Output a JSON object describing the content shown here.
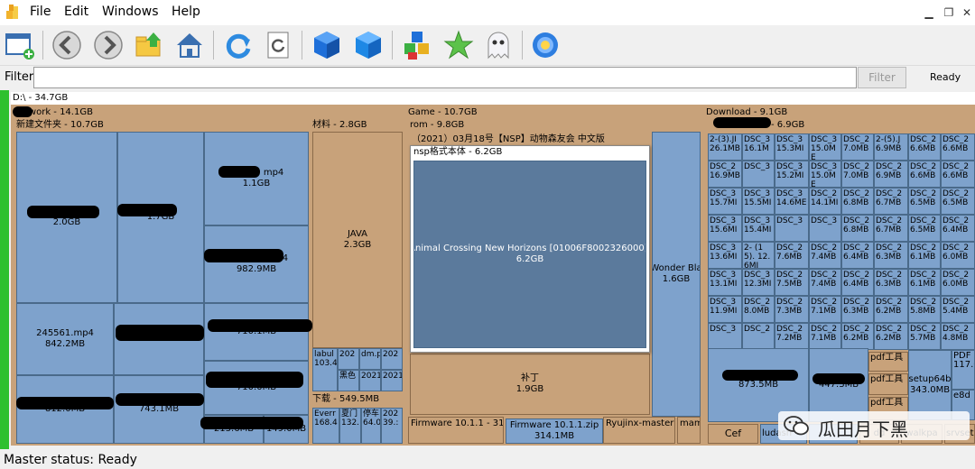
{
  "menu": {
    "file": "File",
    "edit": "Edit",
    "windows": "Windows",
    "help": "Help"
  },
  "filter": {
    "label": "Filter",
    "value": "",
    "button": "Filter",
    "status": "Ready"
  },
  "path_header": "D:\\ - 34.7GB",
  "sections": {
    "work": {
      "header": "work - 14.1GB",
      "sub": "新建文件夹 - 10.7GB",
      "materials": "材料 - 2.8GB",
      "downloads": "下载 - 549.5MB"
    },
    "game": {
      "header": "Game - 10.7GB",
      "rom": "rom - 9.8GB",
      "nsp_folder": "（2021）03月18号【NSP】动物森友会 中文版",
      "nsp_popup": "nsp格式本体 - 6.2GB"
    },
    "download": {
      "header": "Download - 9.1GB",
      "sub": "- 6.9GB"
    }
  },
  "blocks": {
    "b1": {
      "name": "mp4",
      "size": "2.0GB"
    },
    "b2": {
      "name": "",
      "size": "1.7GB"
    },
    "b3": {
      "name": "mp4",
      "size": "1.1GB"
    },
    "b4": {
      "name": "mp4",
      "size": "982.9MB"
    },
    "b5": {
      "name": "245561.mp4",
      "size": "842.2MB"
    },
    "b6": {
      "name": "",
      "size": "790.0MB"
    },
    "b7": {
      "name": "",
      "size": "710.1MB"
    },
    "b8": {
      "name": "",
      "size": "710.0MB"
    },
    "b9": {
      "name": "",
      "size": "812.0MB"
    },
    "b10": {
      "name": "",
      "size": "743.1MB"
    },
    "b11": {
      "name": "",
      "size": "213.6MB"
    },
    "b12": {
      "name": "",
      "size": "149.0MB"
    },
    "java": {
      "name": "JAVA",
      "size": "2.3GB"
    },
    "animal": {
      "name": "Animal Crossing New Horizons [01006F8002326000].",
      "size": "6.2GB"
    },
    "patch": {
      "name": "补丁",
      "size": "1.9GB"
    },
    "wonder": {
      "name": "Wonder Bla",
      "size": "1.6GB"
    },
    "fw1": {
      "name": "Firmware 10.1.1 - 314"
    },
    "fw2": {
      "name": "Firmware 10.1.1.zip",
      "size": "314.1MB"
    },
    "ryu": {
      "name": "Ryujinx-master"
    },
    "mam": {
      "name": "mam"
    },
    "dl1": {
      "name": "",
      "size": "873.5MB"
    },
    "dl2": {
      "name": "",
      "size": "447.3MB"
    },
    "setup": {
      "name": "setup64b",
      "size": "343.0MB"
    },
    "pdf1": {
      "name": "pdf工具"
    },
    "pdf2": {
      "name": "pdf工具"
    },
    "pdf3": {
      "name": "pdf工具"
    },
    "pdfr": {
      "name": "PDF",
      "size": "117.0"
    },
    "e8d": {
      "name": "e8d"
    },
    "cef": {
      "name": "Cef"
    },
    "ludash": {
      "name": "ludash"
    },
    "dd": {
      "name": "dd"
    },
    "walkpa": {
      "name": "walkpa"
    },
    "srvset": {
      "name": "srvset"
    }
  },
  "small_work": [
    {
      "name": "labul",
      "size": "103.4"
    },
    {
      "name": "202",
      "size": "黑色"
    },
    {
      "name": "dm.p",
      "size": ""
    },
    {
      "name": "202",
      "size": ""
    },
    {
      "name": "",
      "size": ""
    },
    {
      "name": "",
      "size": "2021"
    },
    {
      "name": "",
      "size": "2021"
    },
    {
      "name": "",
      "size": ""
    }
  ],
  "small_dl": [
    {
      "name": "Everr",
      "size": "168.4"
    },
    {
      "name": "夏门",
      "size": "132."
    },
    {
      "name": "停车",
      "size": "64.0"
    },
    {
      "name": "202",
      "size": "39.:"
    }
  ],
  "dsc_grid": [
    [
      "2-(3).JI 26.1MB",
      "DSC_3 16.1M",
      "DSC_3 15.3MI",
      "DSC_3 15.0ME",
      "DSC_2 7.0MB",
      "2-(5).J 6.9MB",
      "DSC_2 6.6MB",
      "DSC_2 6.6MB"
    ],
    [
      "DSC_2 16.9MB",
      "DSC_3",
      "DSC_3 15.2MI",
      "DSC_3 15.0ME",
      "DSC_2 7.0MB",
      "DSC_2 6.9MB",
      "DSC_2 6.6MB",
      "DSC_2 6.6MB"
    ],
    [
      "DSC_3 15.7MI",
      "DSC_3 15.5MI",
      "DSC_3 14.6ME",
      "DSC_2 14.1MI",
      "DSC_2 6.8MB",
      "DSC_2 6.7MB",
      "DSC_2 6.5MB",
      "DSC_2 6.5MB"
    ],
    [
      "DSC_3 15.6MI",
      "DSC_3 15.4MI",
      "DSC_3",
      "DSC_3",
      "DSC_2 6.8MB",
      "DSC_2 6.7MB",
      "DSC_2 6.5MB",
      "DSC_2 6.4MB"
    ],
    [
      "DSC_3 13.6MI",
      "2- (15). 12.6MI",
      "DSC_2 7.6MB",
      "DSC_2 7.4MB",
      "DSC_2 6.4MB",
      "DSC_2 6.3MB",
      "DSC_2 6.1MB",
      "DSC_2 6.0MB"
    ],
    [
      "DSC_3 13.1MI",
      "DSC_3 12.3MI",
      "DSC_2 7.5MB",
      "DSC_2 7.4MB",
      "DSC_2 6.4MB",
      "DSC_2 6.3MB",
      "DSC_2 6.1MB",
      "DSC_2 6.0MB"
    ],
    [
      "DSC_3 11.9MI",
      "DSC_2 8.0MB",
      "DSC_2 7.3MB",
      "DSC_2 7.1MB",
      "DSC_2 6.3MB",
      "DSC_2 6.2MB",
      "DSC_2 5.8MB",
      "DSC_2 5.4MB"
    ],
    [
      "DSC_3",
      "DSC_2",
      "DSC_2 7.2MB",
      "DSC_2 7.1MB",
      "DSC_2 6.2MB",
      "DSC_2 6.2MB",
      "DSC_2 5.7MB",
      "DSC_2 4.8MB"
    ]
  ],
  "watermark": "瓜田月下黑",
  "status": "Master status: Ready",
  "colors": {
    "folder_bg": "#c8a27a",
    "file_bg": "#7ea2cc",
    "selected_bg": "#5b7a9c",
    "indicator": "#2ec02e"
  }
}
